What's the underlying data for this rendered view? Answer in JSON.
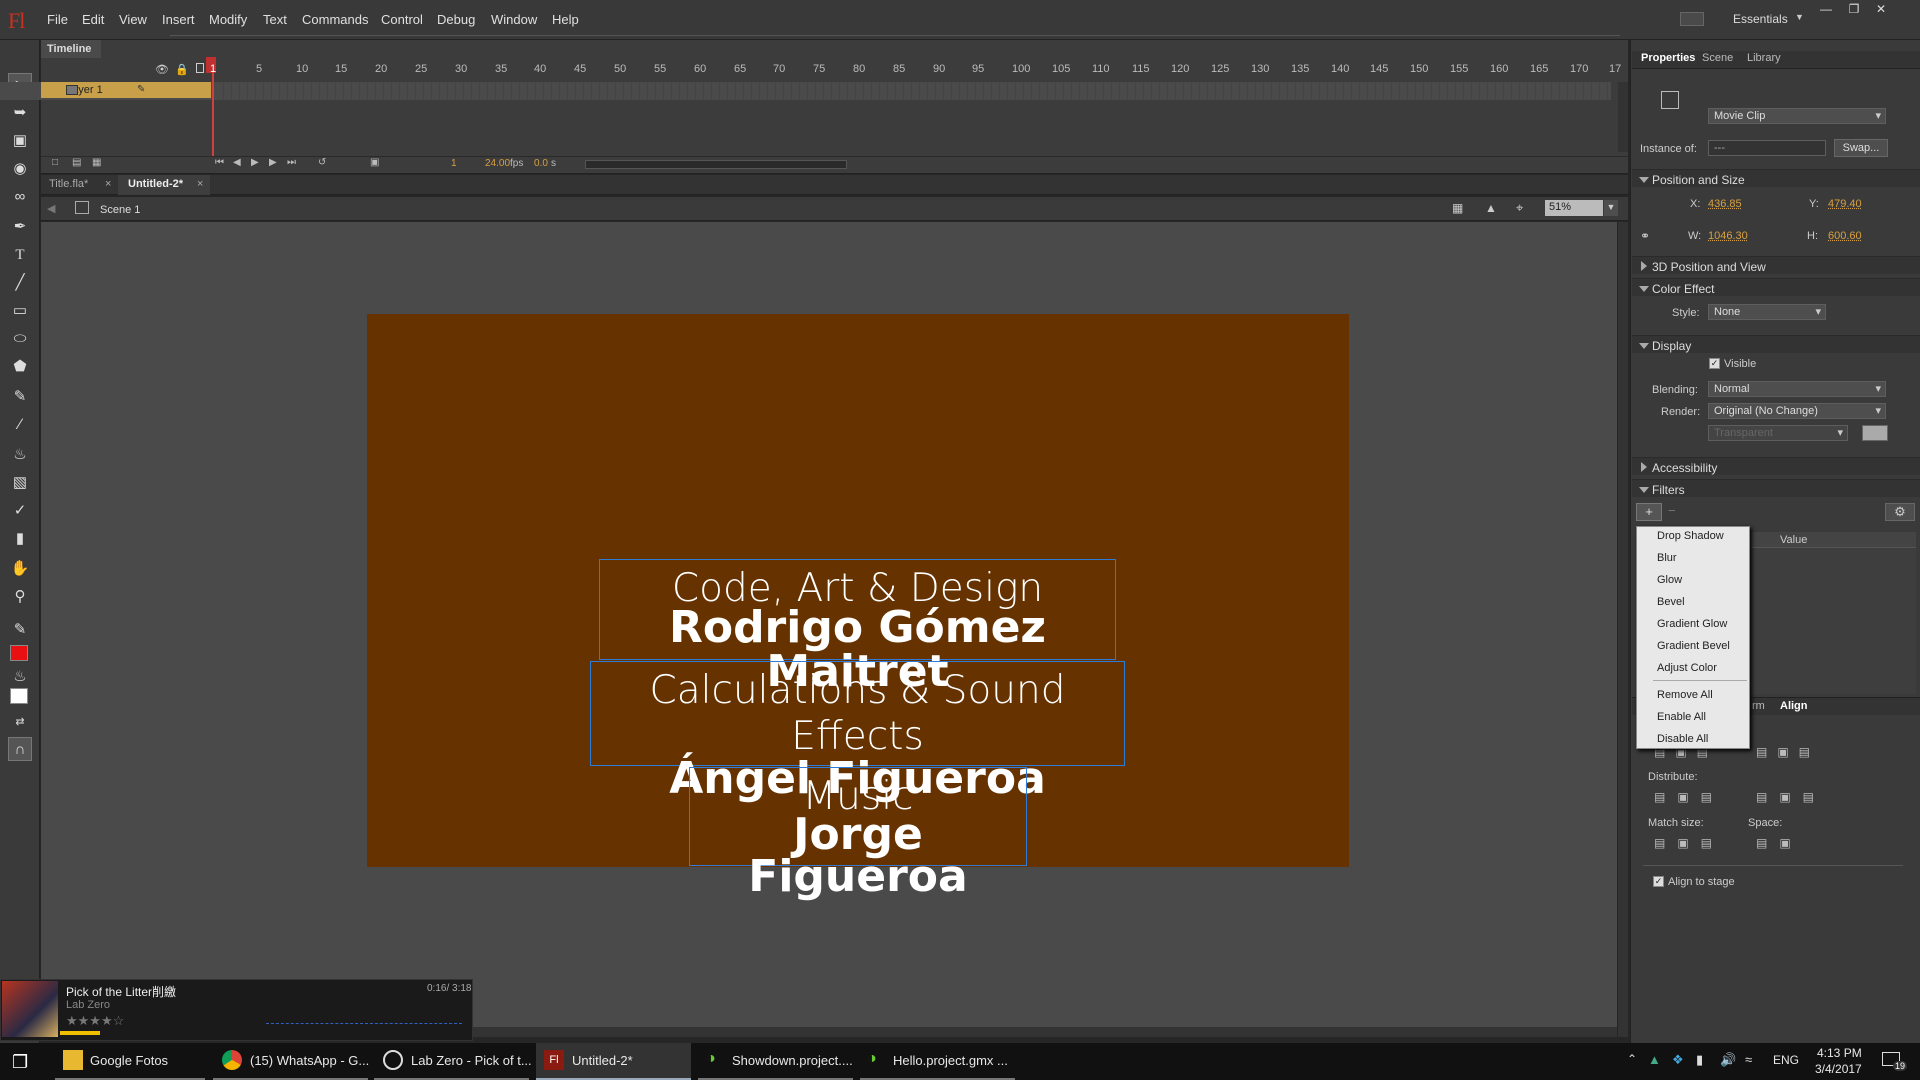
{
  "menubar": {
    "logo": "Fl",
    "items": [
      "File",
      "Edit",
      "View",
      "Insert",
      "Modify",
      "Text",
      "Commands",
      "Control",
      "Debug",
      "Window",
      "Help"
    ],
    "workspace": "Essentials"
  },
  "timeline": {
    "tab": "Timeline",
    "layer": "Layer 1",
    "ticks": [
      "5",
      "10",
      "15",
      "20",
      "25",
      "30",
      "35",
      "40",
      "45",
      "50",
      "55",
      "60",
      "65",
      "70",
      "75",
      "80",
      "85",
      "90",
      "95",
      "100",
      "105",
      "110",
      "115",
      "120",
      "125",
      "130",
      "135",
      "140",
      "145",
      "150",
      "155",
      "160",
      "165",
      "170",
      "17"
    ],
    "first_tick": "1",
    "frame": "1",
    "fps": "24.00",
    "fps_unit": "fps",
    "time": "0.0",
    "time_unit": "s"
  },
  "doctabs": {
    "tab1": "Title.fla*",
    "tab2": "Untitled-2*",
    "close": "×"
  },
  "scene": {
    "name": "Scene 1",
    "zoom": "51%"
  },
  "stage": {
    "bg": "#663200",
    "credits": [
      {
        "role": "Code, Art & Design",
        "name": "Rodrigo Gómez Maitret"
      },
      {
        "role": "Calculations & Sound Effects",
        "name": "Ángel Figueroa"
      },
      {
        "role": "Music",
        "name": "Jorge Figueroa"
      }
    ]
  },
  "properties": {
    "tabs": [
      "Properties",
      "Scene",
      "Library"
    ],
    "instance_type": "Movie Clip",
    "instance_of_label": "Instance of:",
    "instance_of_value": "---",
    "swap": "Swap...",
    "position_size": "Position and Size",
    "x_label": "X:",
    "x": "436.85",
    "y_label": "Y:",
    "y": "479.40",
    "w_label": "W:",
    "w": "1046.30",
    "h_label": "H:",
    "h": "600.60",
    "pos3d": "3D Position and View",
    "color_effect": "Color Effect",
    "style_label": "Style:",
    "style": "None",
    "display": "Display",
    "visible": "Visible",
    "blending_label": "Blending:",
    "blending": "Normal",
    "render_label": "Render:",
    "render": "Original (No Change)",
    "transparent": "Transparent",
    "accessibility": "Accessibility",
    "filters": "Filters",
    "value_col": "Value",
    "filter_menu": [
      "Drop Shadow",
      "Blur",
      "Glow",
      "Bevel",
      "Gradient Glow",
      "Gradient Bevel",
      "Adjust Color"
    ],
    "filter_menu2": [
      "Remove All",
      "Enable All",
      "Disable All"
    ]
  },
  "align": {
    "tab_partial": "rm",
    "tab": "Align",
    "distribute": "Distribute:",
    "match": "Match size:",
    "space": "Space:",
    "to_stage": "Align to stage"
  },
  "music": {
    "title": "Pick of the Litter削繳",
    "artist": "Lab Zero",
    "time": "0:16/ 3:18"
  },
  "taskbar": {
    "items": [
      "Google Fotos",
      "(15) WhatsApp - G...",
      "Lab Zero - Pick of t...",
      "Untitled-2*",
      "Showdown.project....",
      "Hello.project.gmx ..."
    ],
    "lang": "ENG",
    "time": "4:13 PM",
    "date": "3/4/2017",
    "notif": "19"
  }
}
